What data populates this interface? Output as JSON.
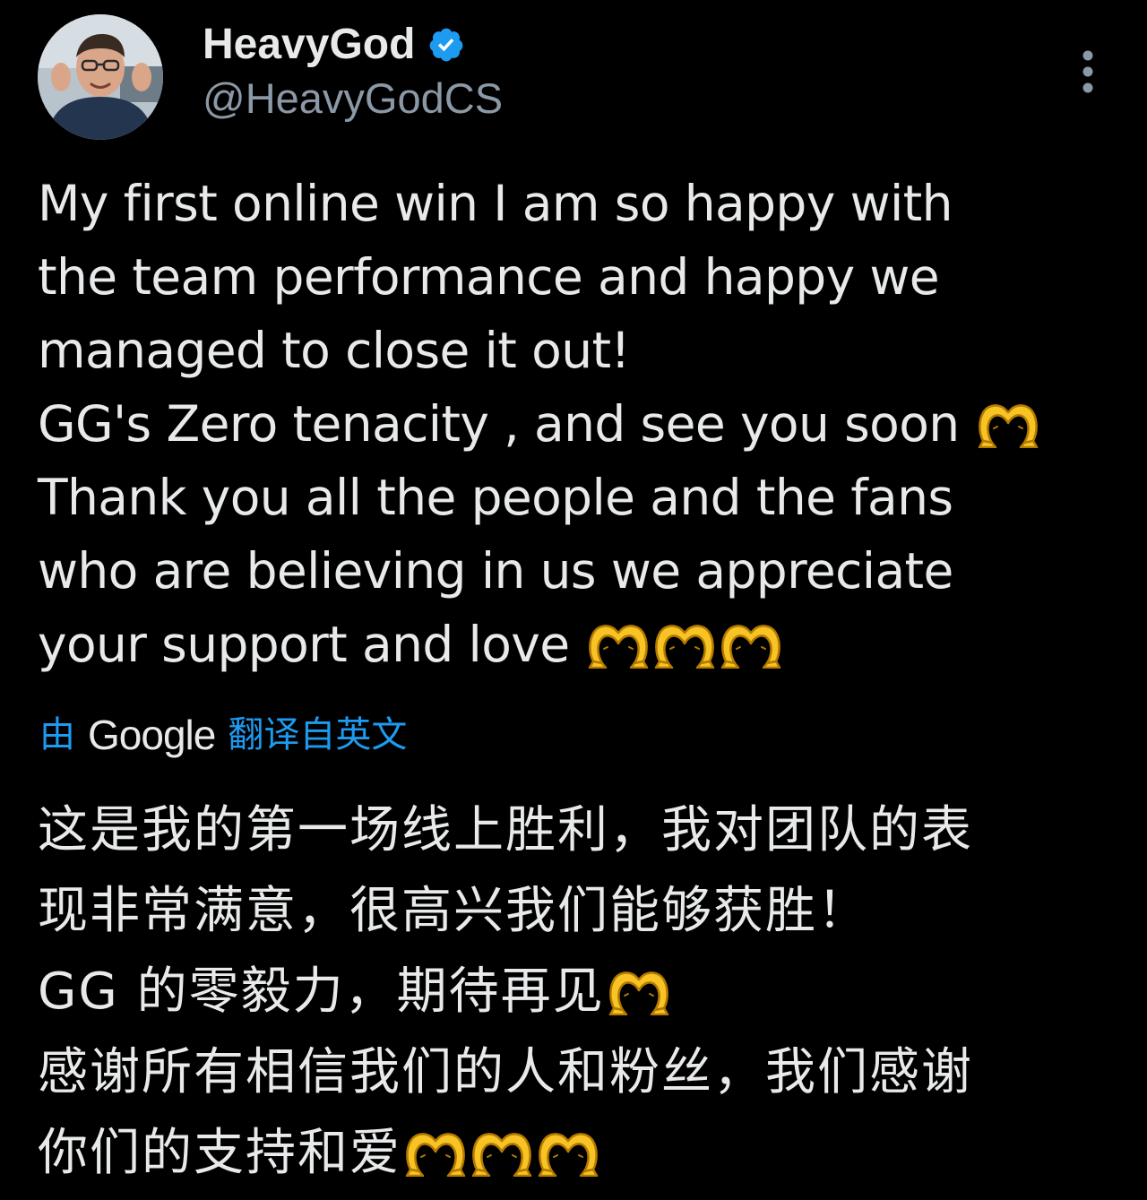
{
  "tweet": {
    "author": {
      "display_name": "HeavyGod",
      "handle": "@HeavyGodCS",
      "verified": true,
      "avatar_icon": "avatar-photo"
    },
    "more_icon": "more-vertical-icon",
    "text_lines": [
      "My first online win I am so happy with",
      "the team performance and happy we",
      "managed to close it out!",
      "GG's Zero tenacity , and see you soon",
      "Thank you all the people and the fans",
      "who are believing in us we appreciate",
      "your support and love"
    ],
    "translation": {
      "prefix": "由",
      "provider": "Google",
      "suffix": "翻译自英文",
      "text_lines": [
        "这是我的第一场线上胜利，我对团队的表",
        "现非常满意，很高兴我们能够获胜！",
        "GG 的零毅力，期待再见",
        "感谢所有相信我们的人和粉丝，我们感谢",
        "你们的支持和爱"
      ]
    },
    "emoji": "heart-hands",
    "colors": {
      "background": "#000000",
      "text": "#e7e9ea",
      "secondary": "#8b98a5",
      "accent": "#1d9bf0",
      "emoji": "#f7c325"
    }
  }
}
